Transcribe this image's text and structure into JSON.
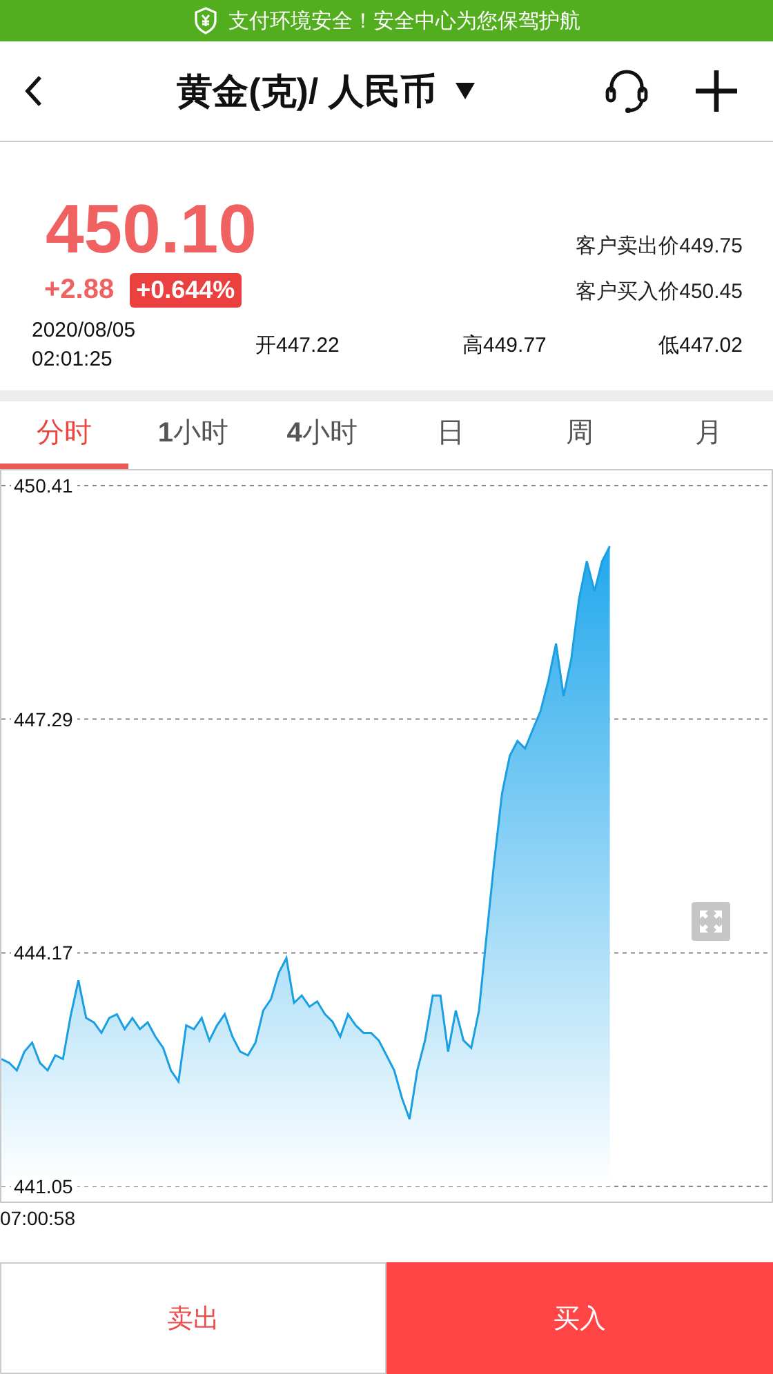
{
  "status_banner": {
    "text": "支付环境安全！安全中心为您保驾护航"
  },
  "header": {
    "title": "黄金(克)/ 人民币"
  },
  "quote": {
    "price": "450.10",
    "change": "+2.88",
    "change_percent": "+0.644%",
    "sell_price": "客户卖出价449.75",
    "buy_price": "客户买入价450.45",
    "date": "2020/08/05",
    "time": "02:01:25",
    "open": "开447.22",
    "high": "高449.77",
    "low": "低447.02"
  },
  "period_tabs": [
    {
      "label": "分时",
      "selected": true
    },
    {
      "label": "**1**小时",
      "selected": false
    },
    {
      "label": "**4**小时",
      "selected": false
    },
    {
      "label": "日",
      "selected": false
    },
    {
      "label": "周",
      "selected": false
    },
    {
      "label": "月",
      "selected": false
    }
  ],
  "chart": {
    "chart_data": {
      "type": "area",
      "ylim": [
        441.05,
        450.41
      ],
      "yticks": [
        {
          "value": 450.41,
          "label": "450.41"
        },
        {
          "value": 447.29,
          "label": "447.29"
        },
        {
          "value": 444.17,
          "label": "444.17"
        },
        {
          "value": 441.05,
          "label": "441.05"
        }
      ],
      "annotations": [
        {
          "text": "07:00:58"
        }
      ],
      "series": [
        {
          "color": "#1a9fe2",
          "values": [
            442.75,
            442.7,
            442.6,
            442.85,
            442.97,
            442.7,
            442.6,
            442.8,
            442.75,
            443.33,
            443.8,
            443.3,
            443.24,
            443.1,
            443.3,
            443.35,
            443.15,
            443.3,
            443.15,
            443.24,
            443.05,
            442.9,
            442.6,
            442.45,
            443.2,
            443.15,
            443.3,
            443.0,
            443.2,
            443.35,
            443.05,
            442.85,
            442.8,
            442.97,
            443.4,
            443.55,
            443.9,
            444.1,
            443.5,
            443.6,
            443.45,
            443.52,
            443.35,
            443.25,
            443.05,
            443.35,
            443.2,
            443.1,
            443.1,
            443.0,
            442.8,
            442.6,
            442.23,
            441.95,
            442.6,
            443.0,
            443.6,
            443.6,
            442.85,
            443.4,
            443.0,
            442.9,
            443.4,
            444.4,
            445.4,
            446.3,
            446.8,
            447.0,
            446.9,
            447.15,
            447.4,
            447.8,
            448.3,
            447.6,
            448.1,
            448.9,
            449.4,
            449.0,
            449.4,
            449.6,
            null,
            null,
            null,
            null,
            null,
            null,
            null,
            null,
            null,
            null,
            null,
            null,
            null,
            null,
            null,
            null,
            null,
            null,
            null,
            null,
            null
          ]
        }
      ]
    }
  },
  "actions": [
    {
      "label": "卖出",
      "kind": "sell"
    },
    {
      "label": "买入",
      "kind": "buy"
    }
  ]
}
